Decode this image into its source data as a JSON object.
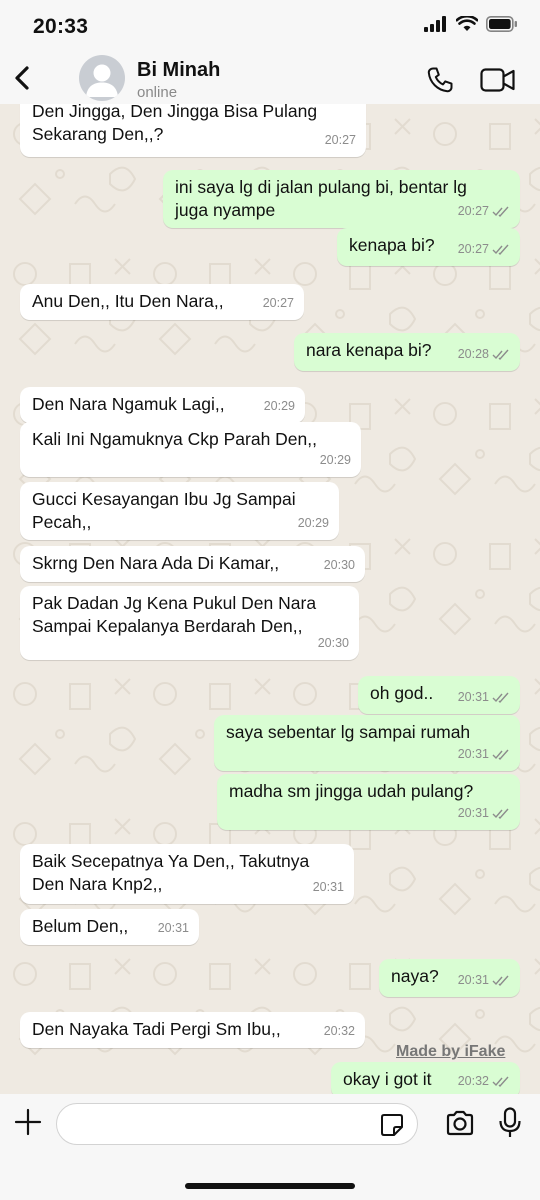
{
  "status_bar": {
    "time": "20:33"
  },
  "header": {
    "contact_name": "Bi Minah",
    "contact_status": "online"
  },
  "messages": [
    {
      "dir": "in",
      "lines": [
        "Den Jingga, Den Jingga Bisa Pulang",
        "Sekarang Den,,?"
      ],
      "time": "20:27"
    },
    {
      "dir": "out",
      "lines": [
        "ini saya lg di jalan pulang bi, bentar lg",
        "juga nyampe"
      ],
      "time": "20:27"
    },
    {
      "dir": "out",
      "lines": [
        "kenapa bi?"
      ],
      "time": "20:27"
    },
    {
      "dir": "in",
      "lines": [
        "Anu Den,, Itu Den Nara,,"
      ],
      "time": "20:27"
    },
    {
      "dir": "out",
      "lines": [
        "nara kenapa bi?"
      ],
      "time": "20:28"
    },
    {
      "dir": "in",
      "lines": [
        "Den Nara Ngamuk Lagi,,"
      ],
      "time": "20:29"
    },
    {
      "dir": "in",
      "lines": [
        "Kali Ini Ngamuknya Ckp Parah Den,,"
      ],
      "time": "20:29"
    },
    {
      "dir": "in",
      "lines": [
        "Gucci Kesayangan Ibu Jg Sampai",
        "Pecah,,"
      ],
      "time": "20:29"
    },
    {
      "dir": "in",
      "lines": [
        "Skrng Den Nara Ada Di Kamar,,"
      ],
      "time": "20:30"
    },
    {
      "dir": "in",
      "lines": [
        "Pak Dadan Jg Kena Pukul Den Nara",
        "Sampai Kepalanya Berdarah Den,,"
      ],
      "time": "20:30"
    },
    {
      "dir": "out",
      "lines": [
        "oh god.."
      ],
      "time": "20:31"
    },
    {
      "dir": "out",
      "lines": [
        "saya sebentar lg sampai rumah"
      ],
      "time": "20:31"
    },
    {
      "dir": "out",
      "lines": [
        "madha sm jingga udah pulang?"
      ],
      "time": "20:31"
    },
    {
      "dir": "in",
      "lines": [
        "Baik Secepatnya Ya Den,, Takutnya",
        "Den Nara Knp2,,"
      ],
      "time": "20:31"
    },
    {
      "dir": "in",
      "lines": [
        "Belum Den,,"
      ],
      "time": "20:31"
    },
    {
      "dir": "out",
      "lines": [
        "naya?"
      ],
      "time": "20:31"
    },
    {
      "dir": "in",
      "lines": [
        "Den Nayaka Tadi Pergi Sm Ibu,,"
      ],
      "time": "20:32"
    },
    {
      "dir": "out",
      "lines": [
        "okay i got it"
      ],
      "time": "20:32"
    }
  ],
  "watermark": "Made by iFake",
  "composer": {
    "value": "",
    "placeholder": ""
  },
  "icons": {
    "back": "chevron-left-icon",
    "avatar": "person-icon",
    "call": "phone-icon",
    "video": "video-camera-icon",
    "add": "plus-icon",
    "sticker": "sticker-icon",
    "camera": "camera-icon",
    "mic": "microphone-icon",
    "read": "double-check-icon"
  },
  "colors": {
    "incoming_bubble": "#ffffff",
    "outgoing_bubble": "#d9fdd3",
    "read_ticks": "#53bdeb",
    "chat_background": "#efeae2"
  }
}
